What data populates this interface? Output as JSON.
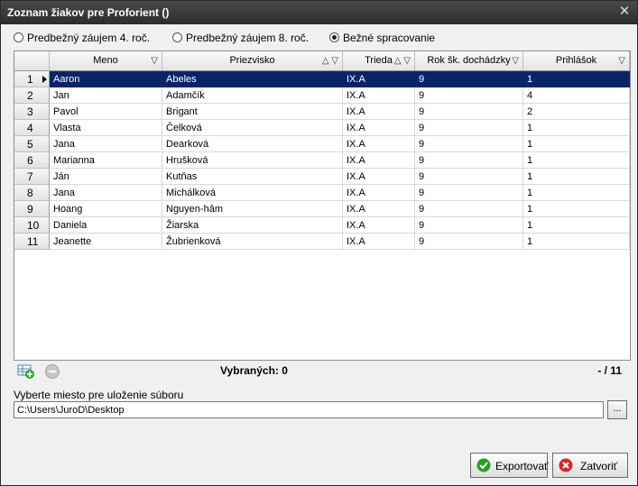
{
  "window": {
    "title": "Zoznam žiakov pre Proforient ()",
    "close_glyph": "✕"
  },
  "filters": [
    {
      "label": "Predbežný záujem 4. roč.",
      "checked": false
    },
    {
      "label": "Predbežný záujem 8. roč.",
      "checked": false
    },
    {
      "label": "Bežné spracovanie",
      "checked": true
    }
  ],
  "columns": [
    {
      "label": "Meno",
      "icons": "filter-icon"
    },
    {
      "label": "Priezvisko",
      "icons": "sort-asc-icon filter-icon"
    },
    {
      "label": "Trieda",
      "icons": "sort-asc-icon filter-icon"
    },
    {
      "label": "Rok šk. dochádzky",
      "icons": "filter-icon"
    },
    {
      "label": "Prihlášok",
      "icons": "filter-icon"
    }
  ],
  "rows": [
    {
      "num": "1",
      "meno": "Aaron",
      "priezvisko": "Abeles",
      "trieda": "IX.A",
      "rok": "9",
      "prihlasok": "1",
      "selected": true
    },
    {
      "num": "2",
      "meno": "Jan",
      "priezvisko": "Adamčík",
      "trieda": "IX.A",
      "rok": "9",
      "prihlasok": "4"
    },
    {
      "num": "3",
      "meno": "Pavol",
      "priezvisko": "Brigant",
      "trieda": "IX.A",
      "rok": "9",
      "prihlasok": "2"
    },
    {
      "num": "4",
      "meno": "Vlasta",
      "priezvisko": "Čelková",
      "trieda": "IX.A",
      "rok": "9",
      "prihlasok": "1"
    },
    {
      "num": "5",
      "meno": "Jana",
      "priezvisko": "Dearková",
      "trieda": "IX.A",
      "rok": "9",
      "prihlasok": "1"
    },
    {
      "num": "6",
      "meno": "Marianna",
      "priezvisko": "Hrušková",
      "trieda": "IX.A",
      "rok": "9",
      "prihlasok": "1"
    },
    {
      "num": "7",
      "meno": "Ján",
      "priezvisko": "Kutňas",
      "trieda": "IX.A",
      "rok": "9",
      "prihlasok": "1"
    },
    {
      "num": "8",
      "meno": "Jana",
      "priezvisko": "Michálková",
      "trieda": "IX.A",
      "rok": "9",
      "prihlasok": "1"
    },
    {
      "num": "9",
      "meno": "Hoang",
      "priezvisko": "Nguyen-hâm",
      "trieda": "IX.A",
      "rok": "9",
      "prihlasok": "1"
    },
    {
      "num": "10",
      "meno": "Daniela",
      "priezvisko": "Žiarska",
      "trieda": "IX.A",
      "rok": "9",
      "prihlasok": "1"
    },
    {
      "num": "11",
      "meno": "Jeanette",
      "priezvisko": "Žubrienková",
      "trieda": "IX.A",
      "rok": "9",
      "prihlasok": "1"
    }
  ],
  "toolbar": {
    "selected_label": "Vybraných: 0",
    "count_label": "- / 11"
  },
  "save": {
    "label": "Vyberte miesto pre uloženie súboru",
    "path": "C:\\Users\\JuroD\\Desktop",
    "browse_label": "..."
  },
  "buttons": {
    "export_label": "Exportovať",
    "close_label": "Zatvoriť"
  },
  "colors": {
    "selection": "#0a246a",
    "export_icon": "#22a022",
    "close_icon": "#d42a2a"
  }
}
